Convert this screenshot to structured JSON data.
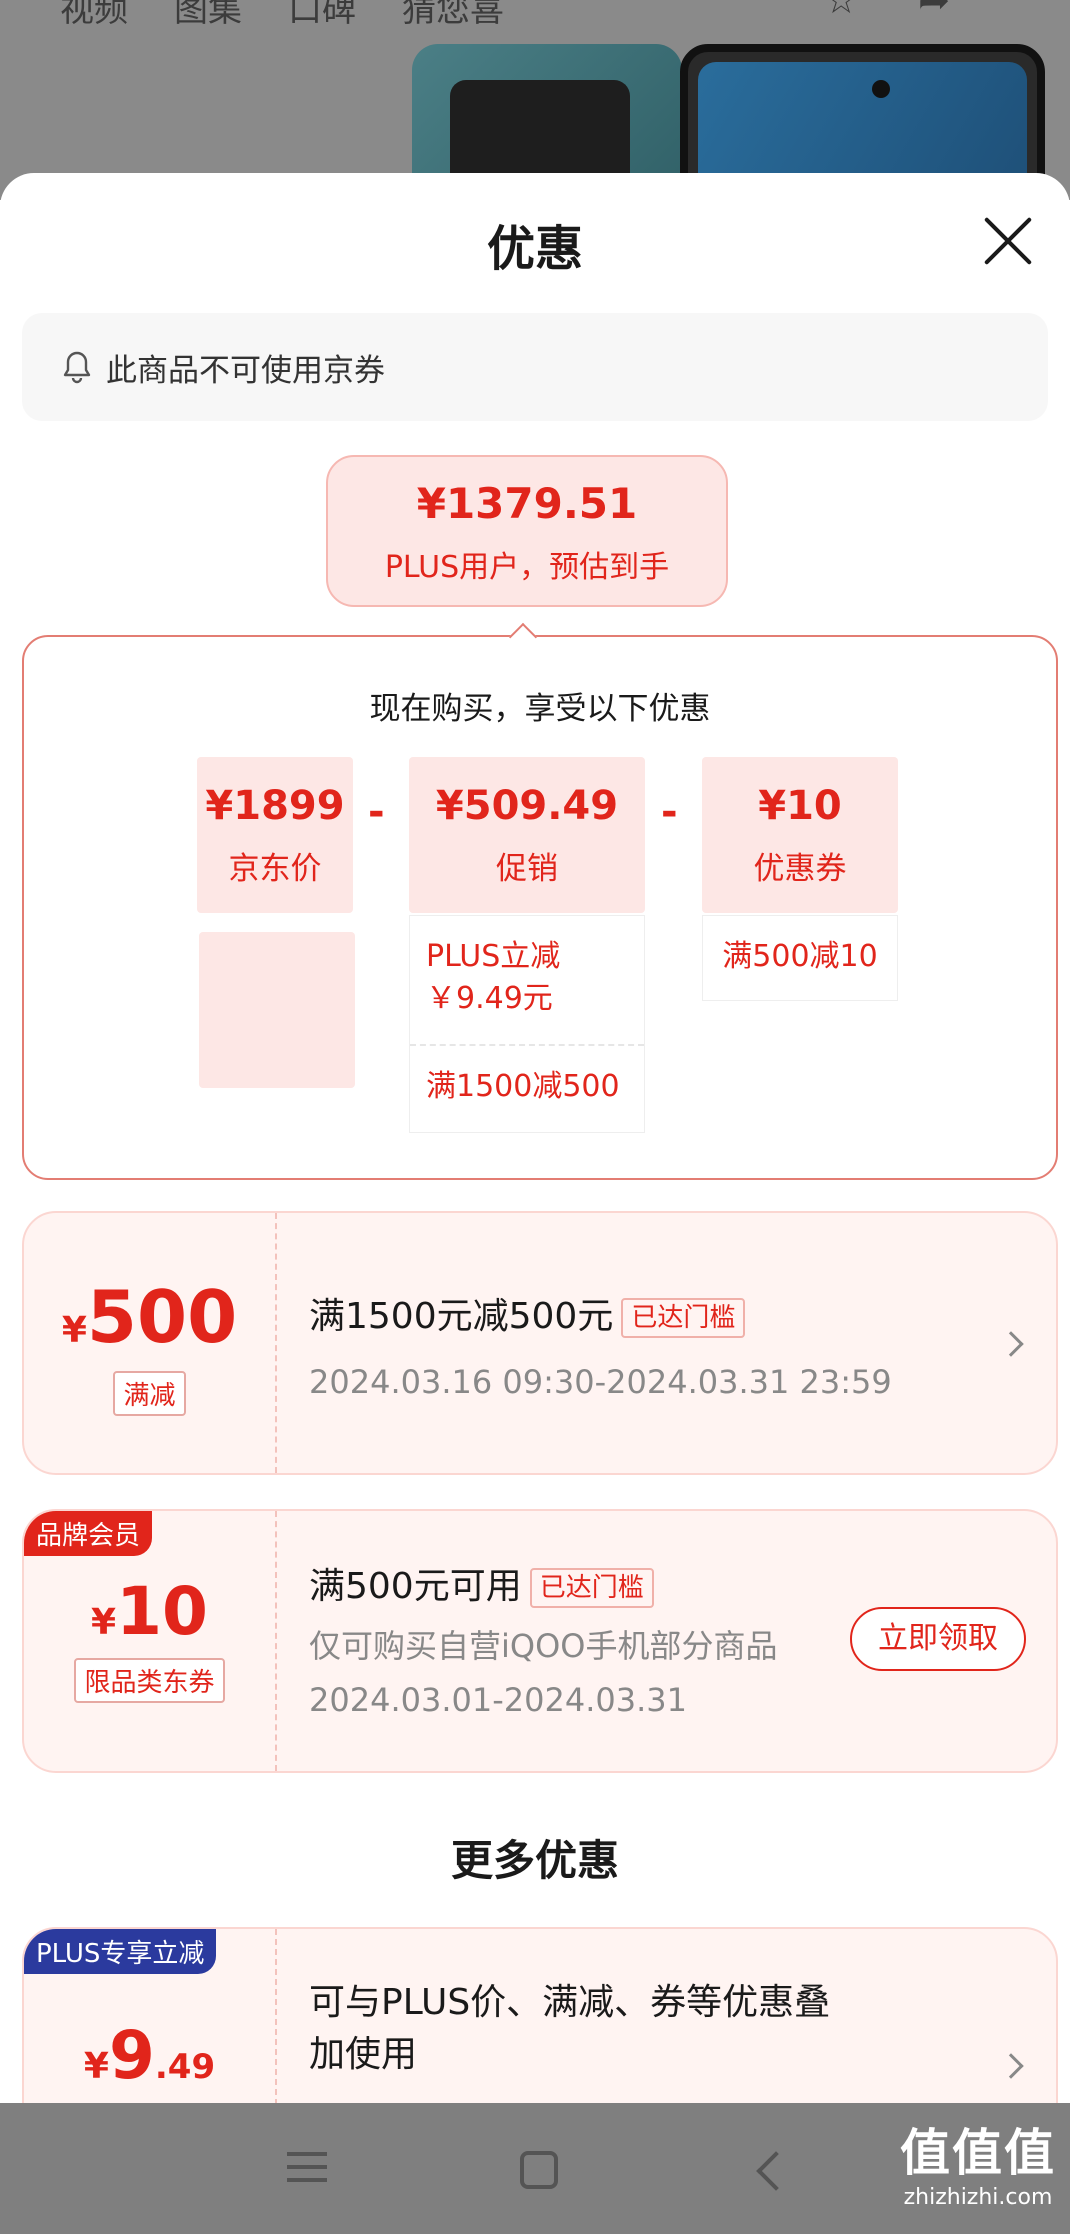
{
  "background": {
    "tabs": [
      "视频",
      "图集",
      "口碑",
      "猜您喜"
    ]
  },
  "sheet": {
    "title": "优惠",
    "notice": "此商品不可使用京券"
  },
  "estimate": {
    "price": "¥1379.51",
    "label": "PLUS用户，预估到手"
  },
  "breakdown": {
    "title": "现在购买，享受以下优惠",
    "operator": "-",
    "jd_price": {
      "amount": "¥1899",
      "label": "京东价"
    },
    "promo": {
      "amount": "¥509.49",
      "label": "促销",
      "details": [
        "PLUS立减\n￥9.49元",
        "满1500减500"
      ]
    },
    "coupon": {
      "amount": "¥10",
      "label": "优惠券",
      "details": [
        "满500减10"
      ]
    }
  },
  "cards": [
    {
      "currency": "¥",
      "amount": "500",
      "tag": "满减",
      "title": "满1500元减500元",
      "pill": "已达门槛",
      "date": "2024.03.16 09:30-2024.03.31 23:59"
    },
    {
      "badge": "品牌会员",
      "currency": "¥",
      "amount": "10",
      "tag": "限品类东券",
      "title": "满500元可用",
      "pill": "已达门槛",
      "desc": "仅可购买自营iQOO手机部分商品",
      "date": "2024.03.01-2024.03.31",
      "button": "立即领取"
    }
  ],
  "more": {
    "title": "更多优惠",
    "card": {
      "badge": "PLUS专享立减",
      "currency": "¥",
      "amount": "9",
      "decimal": ".49",
      "title_line1": "可与PLUS价、满减、券等优惠叠",
      "title_line2": "加使用"
    }
  },
  "watermark": {
    "text": "值值值",
    "domain": "zhizhizhi.com"
  },
  "colors": {
    "accent": "#e1251b",
    "card_bg": "#fff4f2",
    "plus_badge": "#2b3a9e"
  }
}
